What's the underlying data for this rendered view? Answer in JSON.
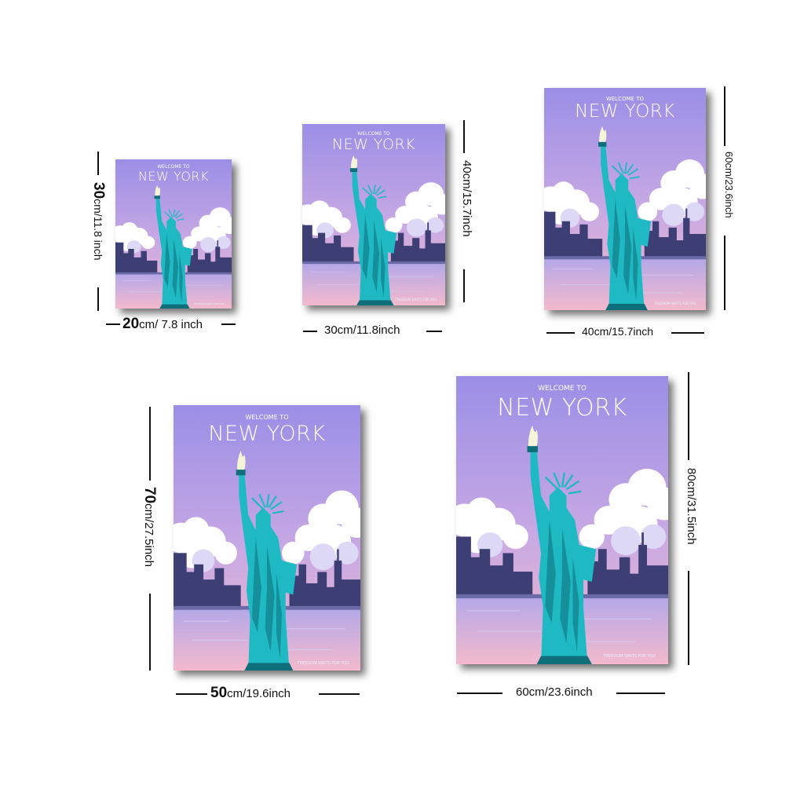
{
  "poster": {
    "welcome": "WELCOME TO",
    "title": "NEW YORK",
    "tagline": "FREEDOM WAITS FOR YOU"
  },
  "sizes": [
    {
      "width_num": "20",
      "width_unit": "cm/ 7.8 inch",
      "height_num": "30",
      "height_unit": "cm/11.8 inch"
    },
    {
      "width_label": "30cm/11.8inch",
      "height_label": "40cm/15.7inch"
    },
    {
      "width_label": "40cm/15.7inch",
      "height_label": "60cm/23.6inch"
    },
    {
      "width_num": "50",
      "width_unit": "cm/19.6inch",
      "height_num": "70",
      "height_unit": "cm/27.5inch"
    },
    {
      "width_label": "60cm/23.6inch",
      "height_label": "80cm/31.5inch"
    }
  ],
  "colors": {
    "sky_top": "#9b8ee6",
    "sky_bottom": "#f0b8c9",
    "statue": "#1fb9c4",
    "statue_dark": "#0e6f7a",
    "skyline": "#3d3f74",
    "water": "#b5a8e8",
    "cloud": "#ffffff",
    "torch_flame": "#f4f4d8"
  }
}
